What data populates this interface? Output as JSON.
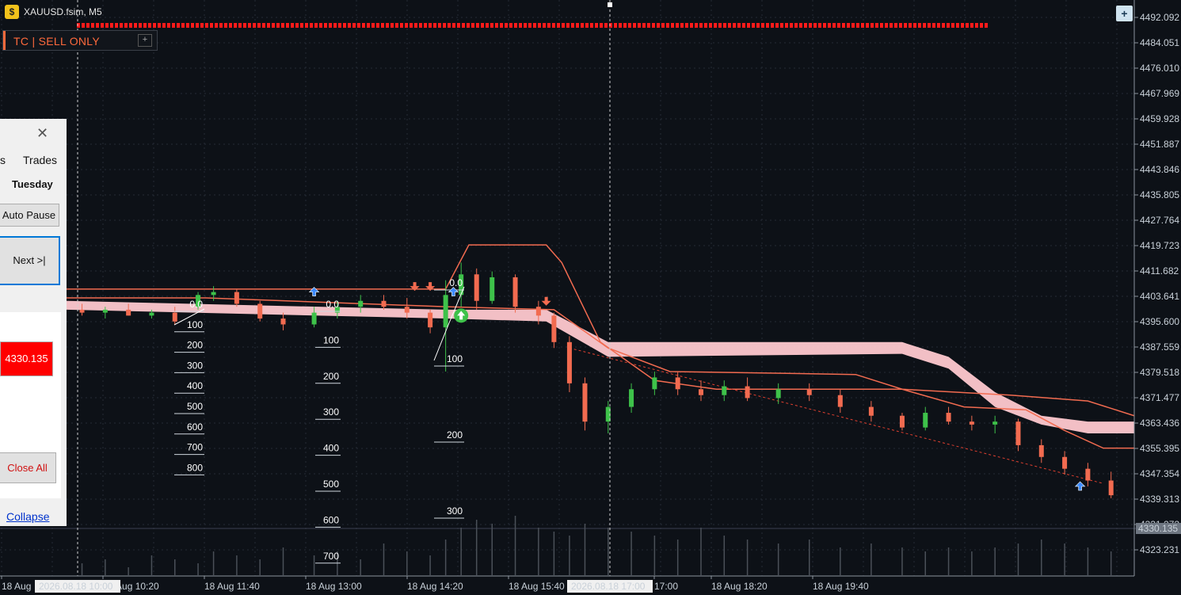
{
  "window": {
    "title": "XAUUSD.fsim, M5"
  },
  "indicator": {
    "label": "TC  |  SELL ONLY",
    "plus": "+"
  },
  "corner_button": "+",
  "panel": {
    "tab_partial": "s",
    "tab_trades": "Trades",
    "day": "Tuesday",
    "auto_pause": "Auto Pause",
    "next": "Next  >|",
    "price": "4330.135",
    "close_all": "Close All",
    "collapse": "Collapse"
  },
  "price_axis": {
    "labels": [
      "4492.092",
      "4484.051",
      "4476.010",
      "4467.969",
      "4459.928",
      "4451.887",
      "4443.846",
      "4435.805",
      "4427.764",
      "4419.723",
      "4411.682",
      "4403.641",
      "4395.600",
      "4387.559",
      "4379.518",
      "4371.477",
      "4363.436",
      "4355.395",
      "4347.354",
      "4339.313",
      "4331.272",
      "4323.231"
    ],
    "current_price": "4330.135"
  },
  "time_axis": {
    "labels": [
      "18 Aug",
      "18 Aug 10:20",
      "18 Aug 11:40",
      "18 Aug 13:00",
      "18 Aug 14:20",
      "18 Aug 15:40",
      "17:00",
      "18 Aug 18:20",
      "18 Aug 19:40"
    ],
    "cursor_1": "2026.08.18 10:00",
    "cursor_2": "2026.08.18 17:00"
  },
  "fib_groups": [
    {
      "labels": [
        "0.0",
        "100",
        "200",
        "300",
        "400",
        "500",
        "600",
        "700",
        "800"
      ]
    },
    {
      "labels": [
        "0.0",
        "100",
        "200",
        "300",
        "400",
        "500",
        "600",
        "700"
      ]
    },
    {
      "labels": [
        "0.0",
        "100",
        "200",
        "300"
      ]
    }
  ],
  "colors": {
    "background": "#0d1117",
    "bear": "#f26b50",
    "bull": "#3ec24a",
    "cloud": "#ffc9cf",
    "signal_red": "#ff1a1a",
    "arrow_blue": "#3d8bfd"
  },
  "chart_data": {
    "type": "candlestick",
    "symbol": "XAUUSD.fsim",
    "timeframe": "M5",
    "ylim": [
      4319,
      4496
    ],
    "xlim": [
      "2026.08.18 09:00",
      "2026.08.18 20:30"
    ],
    "candles": [
      {
        "t": "09:10",
        "o": 4393,
        "h": 4395,
        "l": 4391,
        "c": 4392
      },
      {
        "t": "09:25",
        "o": 4392,
        "h": 4394,
        "l": 4390,
        "c": 4393
      },
      {
        "t": "09:40",
        "o": 4393,
        "h": 4395,
        "l": 4391,
        "c": 4391
      },
      {
        "t": "09:55",
        "o": 4391,
        "h": 4393,
        "l": 4390,
        "c": 4392
      },
      {
        "t": "10:10",
        "o": 4392,
        "h": 4394,
        "l": 4388,
        "c": 4389
      },
      {
        "t": "10:25",
        "o": 4394,
        "h": 4399,
        "l": 4393,
        "c": 4398
      },
      {
        "t": "10:35",
        "o": 4398,
        "h": 4401,
        "l": 4396,
        "c": 4399
      },
      {
        "t": "10:50",
        "o": 4399,
        "h": 4400,
        "l": 4394,
        "c": 4395
      },
      {
        "t": "11:05",
        "o": 4395,
        "h": 4396,
        "l": 4389,
        "c": 4390
      },
      {
        "t": "11:20",
        "o": 4390,
        "h": 4392,
        "l": 4386,
        "c": 4388
      },
      {
        "t": "11:40",
        "o": 4388,
        "h": 4394,
        "l": 4387,
        "c": 4392
      },
      {
        "t": "11:55",
        "o": 4392,
        "h": 4396,
        "l": 4390,
        "c": 4394
      },
      {
        "t": "12:10",
        "o": 4394,
        "h": 4398,
        "l": 4392,
        "c": 4396
      },
      {
        "t": "12:25",
        "o": 4396,
        "h": 4398,
        "l": 4393,
        "c": 4394
      },
      {
        "t": "12:40",
        "o": 4394,
        "h": 4397,
        "l": 4390,
        "c": 4392
      },
      {
        "t": "12:55",
        "o": 4392,
        "h": 4393,
        "l": 4385,
        "c": 4387
      },
      {
        "t": "13:05",
        "o": 4387,
        "h": 4403,
        "l": 4372,
        "c": 4398
      },
      {
        "t": "13:15",
        "o": 4398,
        "h": 4409,
        "l": 4394,
        "c": 4405
      },
      {
        "t": "13:25",
        "o": 4405,
        "h": 4407,
        "l": 4393,
        "c": 4396
      },
      {
        "t": "13:35",
        "o": 4396,
        "h": 4406,
        "l": 4395,
        "c": 4404
      },
      {
        "t": "13:50",
        "o": 4404,
        "h": 4405,
        "l": 4392,
        "c": 4394
      },
      {
        "t": "14:05",
        "o": 4394,
        "h": 4396,
        "l": 4388,
        "c": 4391
      },
      {
        "t": "14:15",
        "o": 4391,
        "h": 4392,
        "l": 4380,
        "c": 4382
      },
      {
        "t": "14:25",
        "o": 4382,
        "h": 4384,
        "l": 4365,
        "c": 4368
      },
      {
        "t": "14:35",
        "o": 4368,
        "h": 4370,
        "l": 4352,
        "c": 4355
      },
      {
        "t": "14:50",
        "o": 4355,
        "h": 4362,
        "l": 4351,
        "c": 4360
      },
      {
        "t": "15:05",
        "o": 4360,
        "h": 4368,
        "l": 4358,
        "c": 4366
      },
      {
        "t": "15:20",
        "o": 4366,
        "h": 4372,
        "l": 4364,
        "c": 4370
      },
      {
        "t": "15:35",
        "o": 4370,
        "h": 4372,
        "l": 4364,
        "c": 4366
      },
      {
        "t": "15:50",
        "o": 4366,
        "h": 4369,
        "l": 4362,
        "c": 4364
      },
      {
        "t": "16:05",
        "o": 4364,
        "h": 4369,
        "l": 4362,
        "c": 4367
      },
      {
        "t": "16:20",
        "o": 4367,
        "h": 4370,
        "l": 4362,
        "c": 4363
      },
      {
        "t": "16:40",
        "o": 4363,
        "h": 4368,
        "l": 4361,
        "c": 4366
      },
      {
        "t": "17:00",
        "o": 4366,
        "h": 4368,
        "l": 4362,
        "c": 4364
      },
      {
        "t": "17:20",
        "o": 4364,
        "h": 4366,
        "l": 4358,
        "c": 4360
      },
      {
        "t": "17:40",
        "o": 4360,
        "h": 4362,
        "l": 4355,
        "c": 4357
      },
      {
        "t": "18:00",
        "o": 4357,
        "h": 4358,
        "l": 4352,
        "c": 4353
      },
      {
        "t": "18:15",
        "o": 4353,
        "h": 4360,
        "l": 4352,
        "c": 4358
      },
      {
        "t": "18:30",
        "o": 4358,
        "h": 4360,
        "l": 4354,
        "c": 4355
      },
      {
        "t": "18:45",
        "o": 4355,
        "h": 4357,
        "l": 4352,
        "c": 4354
      },
      {
        "t": "19:00",
        "o": 4354,
        "h": 4357,
        "l": 4351,
        "c": 4355
      },
      {
        "t": "19:15",
        "o": 4355,
        "h": 4356,
        "l": 4345,
        "c": 4347
      },
      {
        "t": "19:30",
        "o": 4347,
        "h": 4349,
        "l": 4341,
        "c": 4343
      },
      {
        "t": "19:45",
        "o": 4343,
        "h": 4345,
        "l": 4337,
        "c": 4339
      },
      {
        "t": "20:00",
        "o": 4339,
        "h": 4341,
        "l": 4333,
        "c": 4335
      },
      {
        "t": "20:15",
        "o": 4335,
        "h": 4338,
        "l": 4329,
        "c": 4330
      }
    ],
    "upper_line": [
      [
        "09:00",
        4400
      ],
      [
        "13:05",
        4400
      ],
      [
        "13:20",
        4415
      ],
      [
        "14:10",
        4415
      ],
      [
        "14:20",
        4409
      ],
      [
        "14:45",
        4382
      ],
      [
        "15:20",
        4369
      ],
      [
        "16:00",
        4366
      ],
      [
        "18:00",
        4366
      ],
      [
        "18:40",
        4360
      ],
      [
        "19:20",
        4359
      ],
      [
        "19:45",
        4352
      ],
      [
        "20:10",
        4346
      ],
      [
        "20:30",
        4346
      ]
    ],
    "lower_line": [
      [
        "09:00",
        4397
      ],
      [
        "10:30",
        4397
      ],
      [
        "13:05",
        4394
      ],
      [
        "14:15",
        4393
      ],
      [
        "14:50",
        4380
      ],
      [
        "15:30",
        4372
      ],
      [
        "17:30",
        4371
      ],
      [
        "18:00",
        4366
      ],
      [
        "19:10",
        4364
      ],
      [
        "20:00",
        4362
      ],
      [
        "20:30",
        4357
      ]
    ],
    "cloud": [
      {
        "t": "09:00",
        "top": 4396,
        "bottom": 4393
      },
      {
        "t": "13:05",
        "top": 4393,
        "bottom": 4390
      },
      {
        "t": "14:10",
        "top": 4393,
        "bottom": 4389
      },
      {
        "t": "14:50",
        "top": 4382,
        "bottom": 4377
      },
      {
        "t": "18:00",
        "top": 4382,
        "bottom": 4378
      },
      {
        "t": "18:30",
        "top": 4377,
        "bottom": 4373
      },
      {
        "t": "19:00",
        "top": 4365,
        "bottom": 4360
      },
      {
        "t": "19:30",
        "top": 4357,
        "bottom": 4354
      },
      {
        "t": "20:00",
        "top": 4355,
        "bottom": 4351
      },
      {
        "t": "20:30",
        "top": 4355,
        "bottom": 4351
      }
    ],
    "trend_line": [
      [
        "14:25",
        4380
      ],
      [
        "20:10",
        4334
      ]
    ],
    "signals": [
      {
        "t": "11:40",
        "price": 4399,
        "dir": "up",
        "color": "blue"
      },
      {
        "t": "12:45",
        "price": 4401,
        "dir": "down",
        "color": "red"
      },
      {
        "t": "12:55",
        "price": 4401,
        "dir": "down",
        "color": "red"
      },
      {
        "t": "13:10",
        "price": 4399,
        "dir": "up",
        "color": "blue"
      },
      {
        "t": "13:15",
        "price": 4391,
        "dir": "up",
        "color": "green"
      },
      {
        "t": "14:10",
        "price": 4396,
        "dir": "down",
        "color": "red"
      },
      {
        "t": "19:55",
        "price": 4333,
        "dir": "up",
        "color": "blue"
      }
    ],
    "volume": [
      3,
      4,
      2,
      5,
      4,
      3,
      6,
      5,
      4,
      7,
      5,
      6,
      4,
      8,
      6,
      5,
      9,
      12,
      14,
      13,
      15,
      12,
      11,
      10,
      13,
      12,
      11,
      10,
      9,
      12,
      10,
      9,
      8,
      9,
      7,
      8,
      7,
      6,
      7,
      6,
      7,
      8,
      9,
      8,
      7,
      6
    ]
  }
}
